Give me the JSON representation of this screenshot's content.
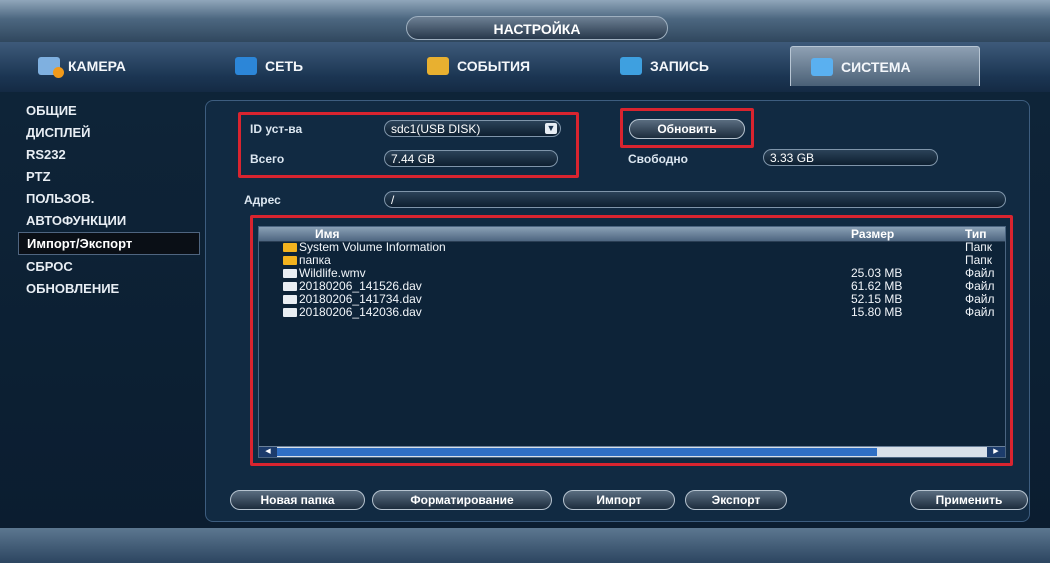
{
  "header": {
    "title": "НАСТРОЙКА"
  },
  "tabs": [
    {
      "label": "КАМЕРА",
      "icon": "camera-icon"
    },
    {
      "label": "СЕТЬ",
      "icon": "network-icon"
    },
    {
      "label": "СОБЫТИЯ",
      "icon": "event-icon"
    },
    {
      "label": "ЗАПИСЬ",
      "icon": "record-icon"
    },
    {
      "label": "СИСТЕМА",
      "icon": "system-icon",
      "active": true
    }
  ],
  "sidebar": {
    "items": [
      {
        "label": "ОБЩИЕ"
      },
      {
        "label": "ДИСПЛЕЙ"
      },
      {
        "label": "RS232"
      },
      {
        "label": "PTZ"
      },
      {
        "label": "ПОЛЬЗОВ."
      },
      {
        "label": "АВТОФУНКЦИИ"
      },
      {
        "label": "Импорт/Экспорт",
        "selected": true
      },
      {
        "label": "СБРОС"
      },
      {
        "label": "ОБНОВЛЕНИЕ"
      }
    ]
  },
  "device": {
    "id_label": "ID уст-ва",
    "id_value": "sdc1(USB DISK)",
    "total_label": "Всего",
    "total_value": "7.44 GB",
    "refresh_label": "Обновить",
    "free_label": "Свободно",
    "free_value": "3.33 GB"
  },
  "address": {
    "label": "Адрес",
    "value": "/"
  },
  "file_list": {
    "columns": [
      "Имя",
      "Размер",
      "Тип"
    ],
    "rows": [
      {
        "name": "System Volume Information",
        "size": "",
        "type": "Папк",
        "kind": "folder"
      },
      {
        "name": "папка",
        "size": "",
        "type": "Папк",
        "kind": "folder"
      },
      {
        "name": "Wildlife.wmv",
        "size": "25.03 MB",
        "type": "Файл",
        "kind": "file"
      },
      {
        "name": "20180206_141526.dav",
        "size": "61.62 MB",
        "type": "Файл",
        "kind": "file"
      },
      {
        "name": "20180206_141734.dav",
        "size": "52.15 MB",
        "type": "Файл",
        "kind": "file"
      },
      {
        "name": "20180206_142036.dav",
        "size": "15.80 MB",
        "type": "Файл",
        "kind": "file"
      }
    ]
  },
  "buttons": {
    "new_folder": "Новая папка",
    "format": "Форматирование",
    "import": "Импорт",
    "export": "Экспорт",
    "apply": "Применить"
  },
  "colors": {
    "highlight_red": "#d9242f",
    "folder": "#f3b31e"
  }
}
